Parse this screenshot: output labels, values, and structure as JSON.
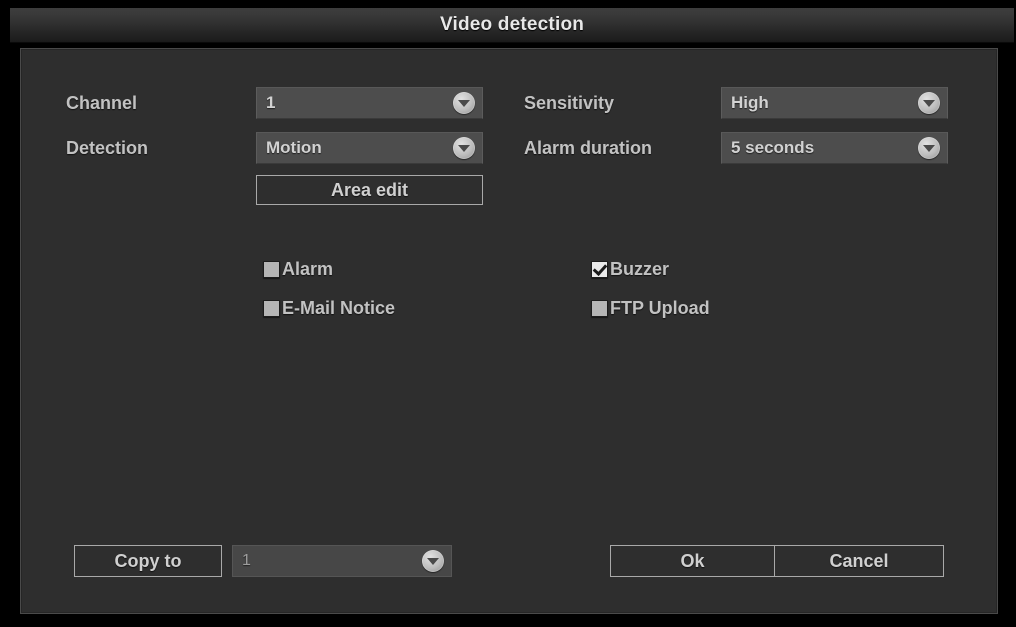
{
  "window": {
    "title": "Video detection"
  },
  "form": {
    "channel": {
      "label": "Channel",
      "value": "1"
    },
    "detection": {
      "label": "Detection",
      "value": "Motion"
    },
    "sensitivity": {
      "label": "Sensitivity",
      "value": "High"
    },
    "alarm_duration": {
      "label": "Alarm duration",
      "value": "5 seconds"
    },
    "area_edit_label": "Area edit"
  },
  "checkboxes": [
    {
      "name": "alarm",
      "label": "Alarm",
      "checked": false
    },
    {
      "name": "buzzer",
      "label": "Buzzer",
      "checked": true
    },
    {
      "name": "email",
      "label": "E-Mail Notice",
      "checked": false
    },
    {
      "name": "ftp",
      "label": "FTP Upload",
      "checked": false
    }
  ],
  "footer": {
    "copy_to_label": "Copy to",
    "copy_to_value": "1",
    "ok_label": "Ok",
    "cancel_label": "Cancel"
  },
  "icons": {
    "dropdown_arrow": "chevron-down-icon",
    "checkmark": "check-icon"
  },
  "colors": {
    "window_bg": "#000000",
    "panel_bg": "#2e2e2e",
    "titlebar_top": "#3d3d3d",
    "dropdown_bg": "#4d4d4d",
    "text": "#c2c2c2",
    "button_border": "#a9a9a9"
  }
}
